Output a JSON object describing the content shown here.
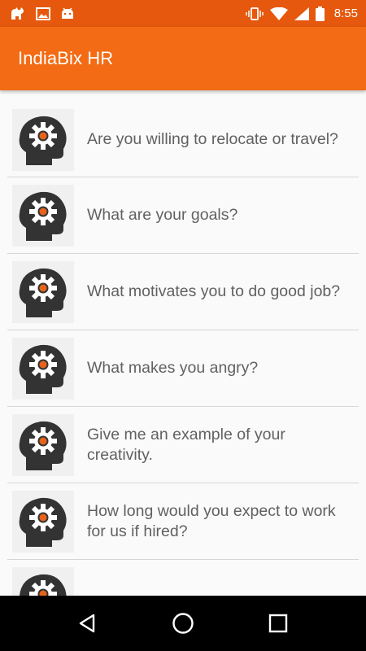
{
  "status_bar": {
    "time": "8:55",
    "left_icons": [
      "cat-icon",
      "image-icon",
      "android-icon"
    ],
    "right_icons": [
      "vibrate-icon",
      "wifi-icon",
      "signal-icon",
      "battery-icon"
    ]
  },
  "app_bar": {
    "title": "IndiaBix HR",
    "color": "#f36b14"
  },
  "questions": [
    {
      "text": "Are you willing to relocate or travel?",
      "icon": "head-gear-icon"
    },
    {
      "text": "What are your goals?",
      "icon": "head-gear-icon"
    },
    {
      "text": "What motivates you to do good job?",
      "icon": "head-gear-icon"
    },
    {
      "text": "What makes you angry?",
      "icon": "head-gear-icon"
    },
    {
      "text": "Give me an example of your creativity.",
      "icon": "head-gear-icon"
    },
    {
      "text": "How long would you expect to work for us if hired?",
      "icon": "head-gear-icon"
    },
    {
      "text": "",
      "icon": "head-gear-icon"
    }
  ],
  "nav_bar": {
    "buttons": [
      "back-icon",
      "home-icon",
      "recents-icon"
    ]
  }
}
